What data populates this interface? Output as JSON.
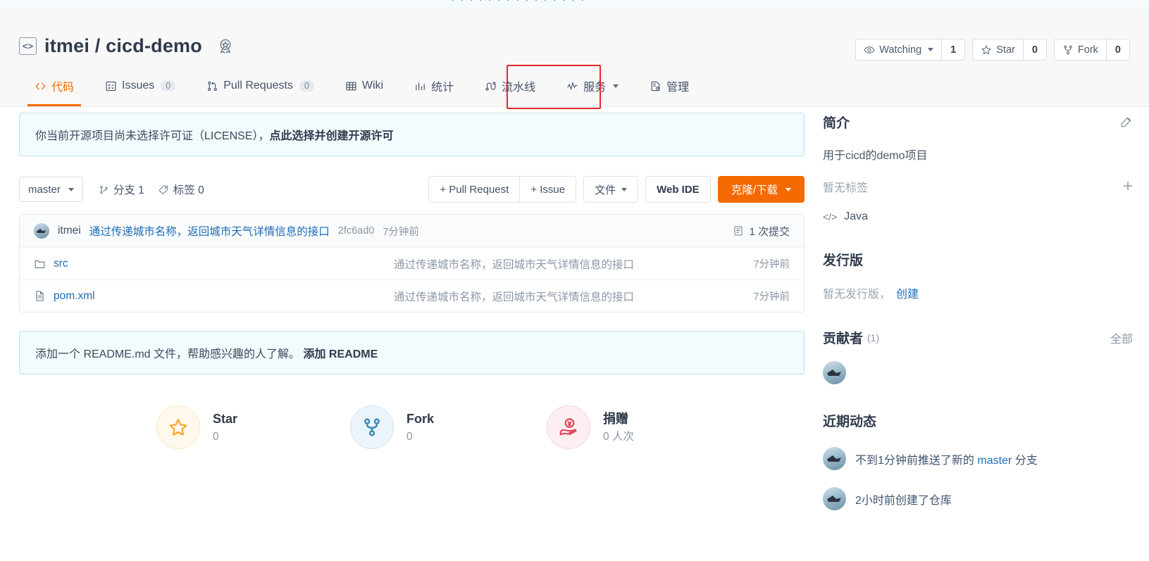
{
  "top_strip": {
    "text": "· · ·   · · · ·    · · · · ·    · · ·"
  },
  "header": {
    "repo_icon": "code-brackets-icon",
    "owner": "itmei",
    "separator": "/",
    "repo": "cicd-demo",
    "full_title": "itmei / cicd-demo",
    "badge_icon": "award-badge-icon",
    "actions": [
      {
        "id": "watching",
        "icon": "eye-icon",
        "label": "Watching",
        "has_caret": true,
        "count": "1"
      },
      {
        "id": "star",
        "icon": "star-icon",
        "label": "Star",
        "has_caret": false,
        "count": "0"
      },
      {
        "id": "fork",
        "icon": "fork-icon",
        "label": "Fork",
        "has_caret": false,
        "count": "0"
      }
    ],
    "tabs": [
      {
        "id": "code",
        "icon": "code-icon",
        "label": "代码",
        "count": null,
        "active": true,
        "caret": false
      },
      {
        "id": "issues",
        "icon": "issue-list-icon",
        "label": "Issues",
        "count": "0",
        "active": false,
        "caret": false
      },
      {
        "id": "pull-requests",
        "icon": "pull-request-icon",
        "label": "Pull Requests",
        "count": "0",
        "active": false,
        "caret": false
      },
      {
        "id": "wiki",
        "icon": "book-icon",
        "label": "Wiki",
        "count": null,
        "active": false,
        "caret": false
      },
      {
        "id": "stats",
        "icon": "bar-chart-icon",
        "label": "统计",
        "count": null,
        "active": false,
        "caret": false
      },
      {
        "id": "pipeline",
        "icon": "pipeline-icon",
        "label": "流水线",
        "count": null,
        "active": false,
        "caret": false
      },
      {
        "id": "service",
        "icon": "activity-icon",
        "label": "服务",
        "count": null,
        "active": false,
        "caret": true
      },
      {
        "id": "manage",
        "icon": "settings-doc-icon",
        "label": "管理",
        "count": null,
        "active": false,
        "caret": false
      }
    ],
    "highlight_tab_id": "pipeline",
    "highlight_color": "#e8272c"
  },
  "license_notice": {
    "text": "你当前开源项目尚未选择许可证（LICENSE），",
    "link": "点此选择并创建开源许可"
  },
  "toolbar": {
    "branch": "master",
    "branch_icon": "branch-icon",
    "branches_label": "分支 1",
    "tags_label": "标签 0",
    "pull_request_label": "+ Pull Request",
    "issue_label": "+ Issue",
    "files_label": "文件",
    "webide_label": "Web IDE",
    "clone_label": "克隆/下载"
  },
  "commit_bar": {
    "author": "itmei",
    "message": "通过传递城市名称，返回城市天气详情信息的接口",
    "hash": "2fc6ad0",
    "time": "7分钟前",
    "count_icon": "commit-history-icon",
    "count_label": "1 次提交"
  },
  "files": [
    {
      "icon": "folder-icon",
      "name": "src",
      "message": "通过传递城市名称，返回城市天气详情信息的接口",
      "time": "7分钟前"
    },
    {
      "icon": "file-icon",
      "name": "pom.xml",
      "message": "通过传递城市名称，返回城市天气详情信息的接口",
      "time": "7分钟前"
    }
  ],
  "readme_notice": {
    "text": "添加一个 README.md 文件，帮助感兴趣的人了解。",
    "link": "添加 README"
  },
  "stats": [
    {
      "id": "star",
      "icon": "star-outline-icon",
      "label": "Star",
      "value": "0",
      "color": "#f7a325"
    },
    {
      "id": "fork",
      "icon": "fork-branch-icon",
      "label": "Fork",
      "value": "0",
      "color": "#3d88b5"
    },
    {
      "id": "donate",
      "icon": "donate-hand-icon",
      "label": "捐赠",
      "value": "0 人次",
      "color": "#e0435c"
    }
  ],
  "sidebar": {
    "intro": {
      "title": "简介",
      "edit_icon": "edit-pencil-icon",
      "description": "用于cicd的demo项目",
      "tags_empty": "暂无标签",
      "add_tag_icon": "plus-icon",
      "language": "Java",
      "language_icon": "code-angle-icon"
    },
    "releases": {
      "title": "发行版",
      "empty_text": "暂无发行版，",
      "create_link": "创建"
    },
    "contributors": {
      "title": "贡献者",
      "count": "(1)",
      "all_link": "全部",
      "avatars": [
        "itmei"
      ]
    },
    "activity": {
      "title": "近期动态",
      "items": [
        {
          "prefix": "不到1分钟前推送了新的 ",
          "highlight": "master",
          "suffix": " 分支"
        },
        {
          "prefix": "2小时前创建了仓库",
          "highlight": "",
          "suffix": ""
        }
      ]
    }
  },
  "colors": {
    "accent": "#f56a00",
    "link": "#1b6cb8",
    "notice_bg": "#f2fbfe",
    "notice_border": "#bfe0ef",
    "highlight": "#e8272c"
  }
}
